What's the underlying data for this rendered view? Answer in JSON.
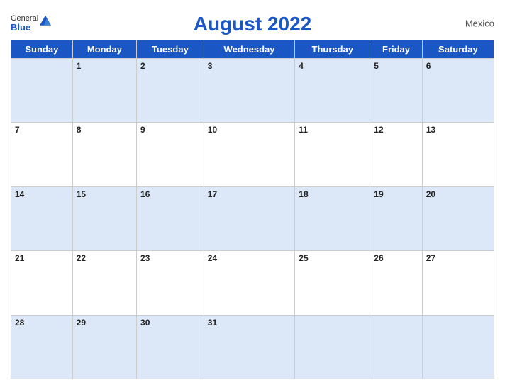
{
  "header": {
    "title": "August 2022",
    "country": "Mexico",
    "logo": {
      "general": "General",
      "blue": "Blue"
    }
  },
  "weekdays": [
    "Sunday",
    "Monday",
    "Tuesday",
    "Wednesday",
    "Thursday",
    "Friday",
    "Saturday"
  ],
  "weeks": [
    [
      null,
      1,
      2,
      3,
      4,
      5,
      6
    ],
    [
      7,
      8,
      9,
      10,
      11,
      12,
      13
    ],
    [
      14,
      15,
      16,
      17,
      18,
      19,
      20
    ],
    [
      21,
      22,
      23,
      24,
      25,
      26,
      27
    ],
    [
      28,
      29,
      30,
      31,
      null,
      null,
      null
    ]
  ]
}
